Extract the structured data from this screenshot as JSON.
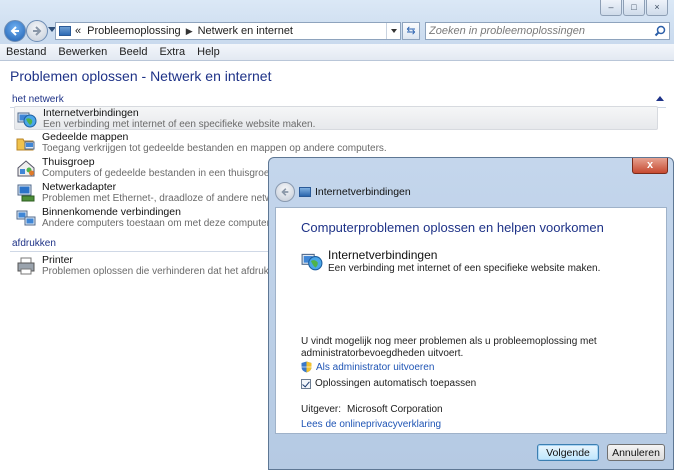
{
  "window": {
    "caption_buttons": [
      "minimize",
      "maximize",
      "close"
    ],
    "address": {
      "prefix": "«",
      "crumbs": [
        "Probleemoplossing",
        "Netwerk en internet"
      ]
    },
    "search_placeholder": "Zoeken in probleemoplossingen",
    "menu": [
      "Bestand",
      "Bewerken",
      "Beeld",
      "Extra",
      "Help"
    ]
  },
  "content": {
    "title": "Problemen oplossen - Netwerk en internet",
    "groups": [
      {
        "label": "het netwerk",
        "items": [
          {
            "name": "Internetverbindingen",
            "desc": "Een verbinding met internet of een specifieke website maken.",
            "icon": "globe-network-icon",
            "selected": true
          },
          {
            "name": "Gedeelde mappen",
            "desc": "Toegang verkrijgen tot gedeelde bestanden en mappen op andere computers.",
            "icon": "shared-folder-icon"
          },
          {
            "name": "Thuisgroep",
            "desc": "Computers of gedeelde bestanden in een thuisgroep weergev",
            "icon": "homegroup-icon"
          },
          {
            "name": "Netwerkadapter",
            "desc": "Problemen met Ethernet-, draadloze of andere netwerkadapte",
            "icon": "network-adapter-icon"
          },
          {
            "name": "Binnenkomende verbindingen",
            "desc": "Andere computers toestaan om met deze computer te comm",
            "icon": "incoming-connections-icon"
          }
        ]
      },
      {
        "label": "afdrukken",
        "items": [
          {
            "name": "Printer",
            "desc": "Problemen oplossen die verhinderen dat het afdrukken wordt",
            "icon": "printer-icon"
          }
        ]
      }
    ]
  },
  "dialog": {
    "window_title": "Internetverbindingen",
    "close_label": "x",
    "heading": "Computerproblemen oplossen en helpen voorkomen",
    "item": {
      "name": "Internetverbindingen",
      "desc": "Een verbinding met internet of een specifieke website maken."
    },
    "note": "U vindt mogelijk nog meer problemen als u probleemoplossing met administratorbevoegdheden uitvoert.",
    "admin_link": "Als administrator uitvoeren",
    "auto_apply_label": "Oplossingen automatisch toepassen",
    "auto_apply_checked": true,
    "publisher_label": "Uitgever:",
    "publisher_value": "Microsoft Corporation",
    "privacy_link": "Lees de onlineprivacyverklaring",
    "buttons": {
      "next": "Volgende",
      "cancel": "Annuleren"
    }
  },
  "colors": {
    "heading_blue": "#1e3287",
    "link_blue": "#1f55b5",
    "close_red": "#c74a31"
  }
}
